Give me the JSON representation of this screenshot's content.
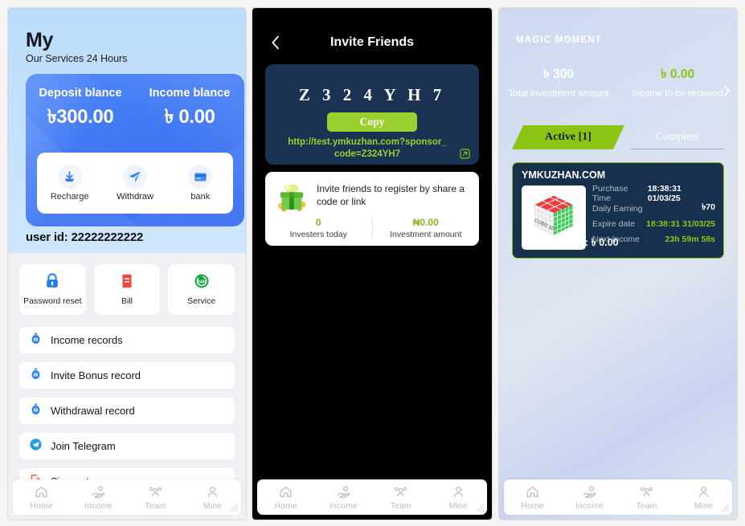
{
  "panels": {
    "mine": {
      "title": "My",
      "subtitle": "Our Services 24 Hours",
      "balances": [
        {
          "label": "Deposit blance",
          "value": "৳300.00"
        },
        {
          "label": "Income blance",
          "value": "৳ 0.00"
        }
      ],
      "actions": [
        {
          "label": "Recharge",
          "icon": "recharge-icon"
        },
        {
          "label": "Withdraw",
          "icon": "withdraw-icon"
        },
        {
          "label": "bank",
          "icon": "bank-card-icon"
        }
      ],
      "user_id": "user id: 22222222222",
      "quick": [
        {
          "label": "Password reset",
          "icon": "lock-icon"
        },
        {
          "label": "Bill",
          "icon": "bill-icon"
        },
        {
          "label": "Service",
          "icon": "service-24h-icon"
        }
      ],
      "rows": [
        {
          "label": "Income records",
          "icon": "money-bag-icon"
        },
        {
          "label": "Invite Bonus record",
          "icon": "money-bag-icon"
        },
        {
          "label": "Withdrawal record",
          "icon": "money-bag-icon"
        },
        {
          "label": "Join Telegram",
          "icon": "telegram-icon"
        },
        {
          "label": "Sign out",
          "icon": "sign-out-icon"
        }
      ]
    },
    "invite": {
      "header_title": "Invite Friends",
      "back_icon": "chevron-left-icon",
      "code": "Z 3 2 4 Y H 7",
      "copy_label": "Copy",
      "link": "http://test.ymkuzhan.com?sponsor_code=Z324YH7",
      "share_icon": "share-square-icon",
      "promo_icon": "gift-box-icon",
      "promo_text": "Invite friends to register by share a code or link",
      "stats": [
        {
          "value": "0",
          "label": "Investers today"
        },
        {
          "value": "₦0.00",
          "label": "Investment amount"
        }
      ]
    },
    "magic": {
      "brand": "MAGIC MOMENT",
      "stats": [
        {
          "value": "৳ 300",
          "label": "Total Investment amount"
        },
        {
          "value": "৳ 0.00",
          "label": "Income to be received"
        }
      ],
      "chevron_icon": "chevron-right-icon",
      "tabs": [
        {
          "label": "Active [1]",
          "selected": true
        },
        {
          "label": "Complete",
          "selected": false
        }
      ],
      "investment": {
        "name": "YMKUZHAN.COM",
        "product_icon": "rubiks-cube-icon",
        "rows": [
          {
            "key": "Purchase Time",
            "value": "18:38:31 01/03/25"
          },
          {
            "key": "Daily Earning",
            "value": "৳70"
          },
          {
            "key": "Expire date",
            "value": "18:38:31 31/03/25"
          },
          {
            "key": "Next Income",
            "value": "23h 59m 58s"
          }
        ],
        "total": "Total Earning: ৳ 0.00"
      }
    }
  },
  "tabbar": [
    {
      "label": "Home",
      "icon": "home-icon"
    },
    {
      "label": "Income",
      "icon": "income-hand-icon"
    },
    {
      "label": "Team",
      "icon": "team-icon"
    },
    {
      "label": "Mine",
      "icon": "person-icon"
    }
  ],
  "colors": {
    "accent_green": "#8cc413",
    "accent_blue": "#3f78f4",
    "card_navy": "#17304e",
    "link_green": "#9ad12e"
  }
}
